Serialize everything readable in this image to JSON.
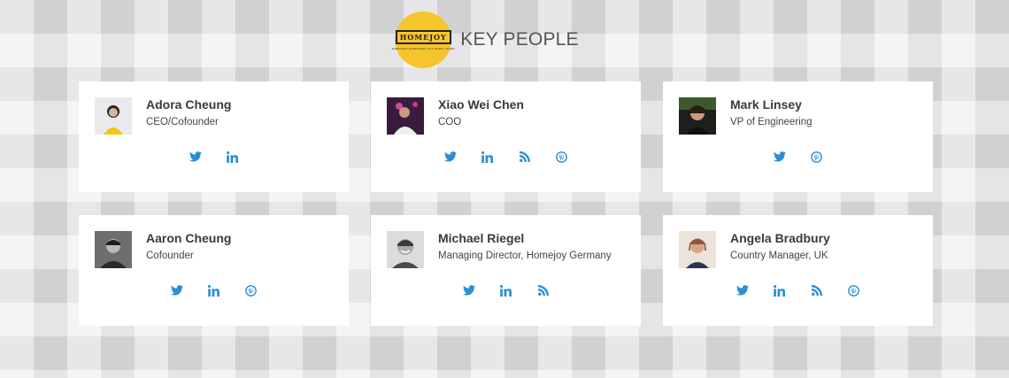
{
  "header": {
    "logo_text": "HOMEJOY",
    "logo_tagline": "everyday happiness in a happy home",
    "title": "KEY PEOPLE",
    "brand_color": "#f6c52c"
  },
  "accent_color": "#2a8fd6",
  "people": [
    {
      "name": "Adora Cheung",
      "role": "CEO/Cofounder",
      "socials": [
        "twitter-icon",
        "linkedin-icon"
      ]
    },
    {
      "name": "Xiao Wei Chen",
      "role": "COO",
      "socials": [
        "twitter-icon",
        "linkedin-icon",
        "rss-icon",
        "pinterest-icon"
      ]
    },
    {
      "name": "Mark Linsey",
      "role": "VP of Engineering",
      "socials": [
        "twitter-icon",
        "pinterest-icon"
      ]
    },
    {
      "name": "Aaron Cheung",
      "role": "Cofounder",
      "socials": [
        "twitter-icon",
        "linkedin-icon",
        "pinterest-icon"
      ]
    },
    {
      "name": "Michael Riegel",
      "role": "Managing Director, Homejoy Germany",
      "socials": [
        "twitter-icon",
        "linkedin-icon",
        "rss-icon"
      ]
    },
    {
      "name": "Angela Bradbury",
      "role": "Country Manager, UK",
      "socials": [
        "twitter-icon",
        "linkedin-icon",
        "rss-icon",
        "pinterest-icon"
      ]
    }
  ]
}
